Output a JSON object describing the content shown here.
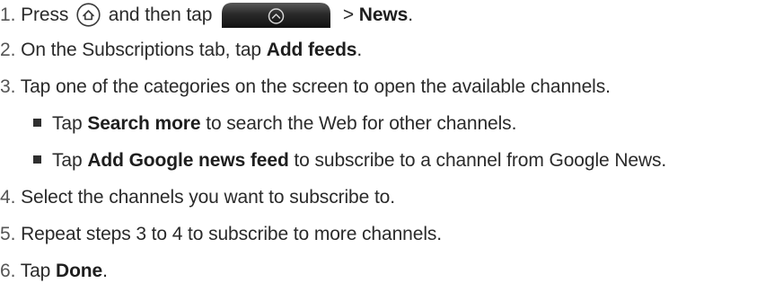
{
  "steps": [
    {
      "num": "1.",
      "press": "Press",
      "mid": "and then tap",
      "gt": ">",
      "news": "News",
      "end": "."
    },
    {
      "num": "2.",
      "pre": "On the Subscriptions tab, tap",
      "bold": "Add feeds",
      "end": "."
    },
    {
      "num": "3.",
      "text": "Tap one of the categories on the screen to open the available channels."
    },
    {
      "num": "4.",
      "text": "Select the channels you want to subscribe to."
    },
    {
      "num": "5.",
      "text": "Repeat steps 3 to 4 to subscribe to more channels."
    },
    {
      "num": "6.",
      "pre": "Tap",
      "bold": "Done",
      "end": "."
    }
  ],
  "bullets": [
    {
      "pre": "Tap",
      "bold": "Search more",
      "post": "to search the Web for other channels."
    },
    {
      "pre": "Tap",
      "bold": "Add Google news feed",
      "post": "to subscribe to a channel from Google News."
    }
  ],
  "icons": {
    "home": "home-icon",
    "all_apps": "all-apps-button-icon"
  },
  "colors": {
    "text": "#2a2a2a",
    "number": "#555555",
    "button_dark": "#1c1c1c"
  }
}
